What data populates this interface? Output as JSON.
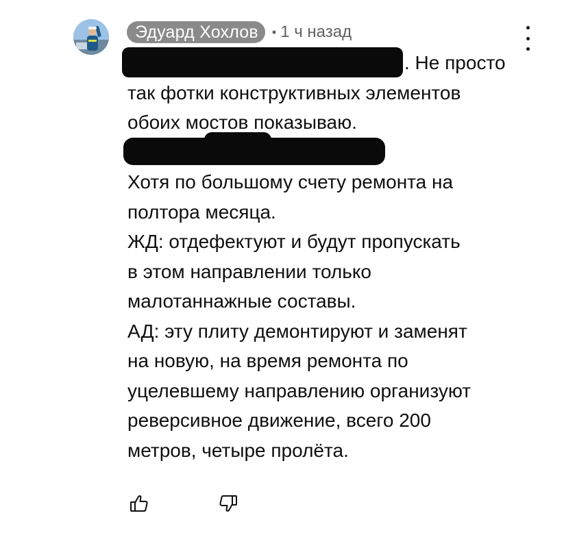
{
  "comment": {
    "author": "Эдуард Хохлов",
    "separator": "•",
    "time": "1 ч назад",
    "lines": [
      ". Не просто",
      "так фотки конструктивных элементов",
      "обоих мостов показываю.",
      "",
      "Хотя по большому счету ремонта на",
      "полтора месяца.",
      "ЖД: отдефектуют и будут пропускать",
      "в этом направлении только",
      "малотаннажные составы.",
      "АД: эту плиту демонтируют и заменят",
      "на новую, на время ремонта по",
      "уцелевшему направлению организуют",
      "реверсивное движение, всего 200",
      "метров, четыре пролёта."
    ]
  },
  "icons": {
    "menu": "more-vertical-icon",
    "like": "thumb-up-icon",
    "dislike": "thumb-down-icon"
  },
  "colors": {
    "text": "#0f0f0f",
    "secondary": "#606060",
    "author_chip": "#8a8a8a",
    "redaction": "#0a0a0a"
  }
}
